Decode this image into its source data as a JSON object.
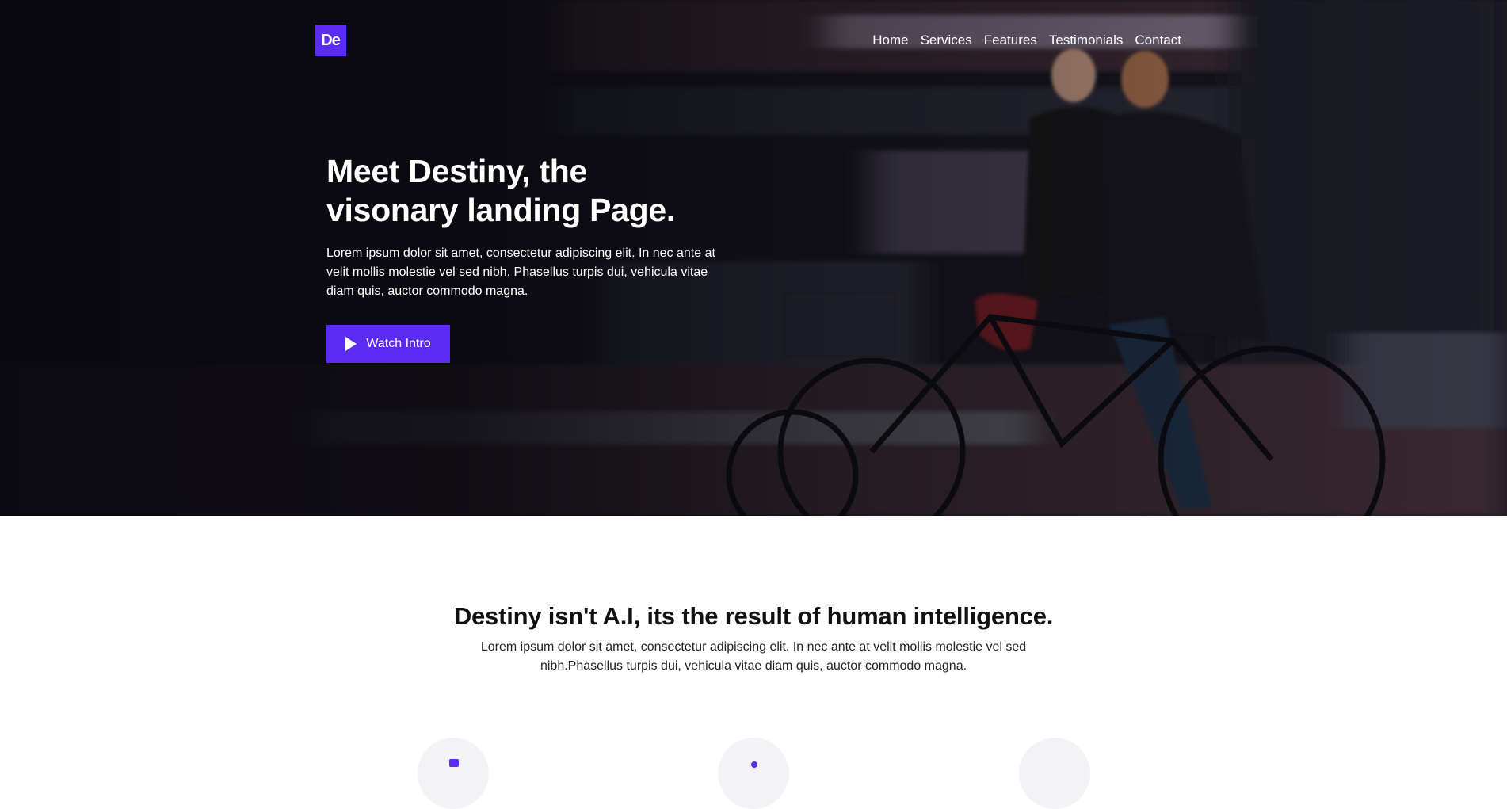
{
  "header": {
    "logo_text": "De",
    "nav": [
      "Home",
      "Services",
      "Features",
      "Testimonials",
      "Contact"
    ]
  },
  "hero": {
    "title_line1": "Meet Destiny, the",
    "title_line2": "visonary landing Page.",
    "text": "Lorem ipsum dolor sit amet, consectetur adipiscing elit. In nec ante at velit mollis molestie vel sed nibh. Phasellus turpis dui, vehicula vitae diam quis, auctor commodo magna.",
    "button_label": "Watch Intro",
    "button_icon": "play-icon"
  },
  "intro": {
    "title": "Destiny isn't A.I, its the result of human intelligence.",
    "text": "Lorem ipsum dolor sit amet, consectetur adipiscing elit. In nec ante at velit mollis molestie vel sed nibh.Phasellus turpis dui, vehicula vitae diam quis, auctor commodo magna."
  },
  "colors": {
    "accent": "#5a2bf0",
    "hero_dark": "#0e0d14",
    "text_dark": "#111111"
  }
}
